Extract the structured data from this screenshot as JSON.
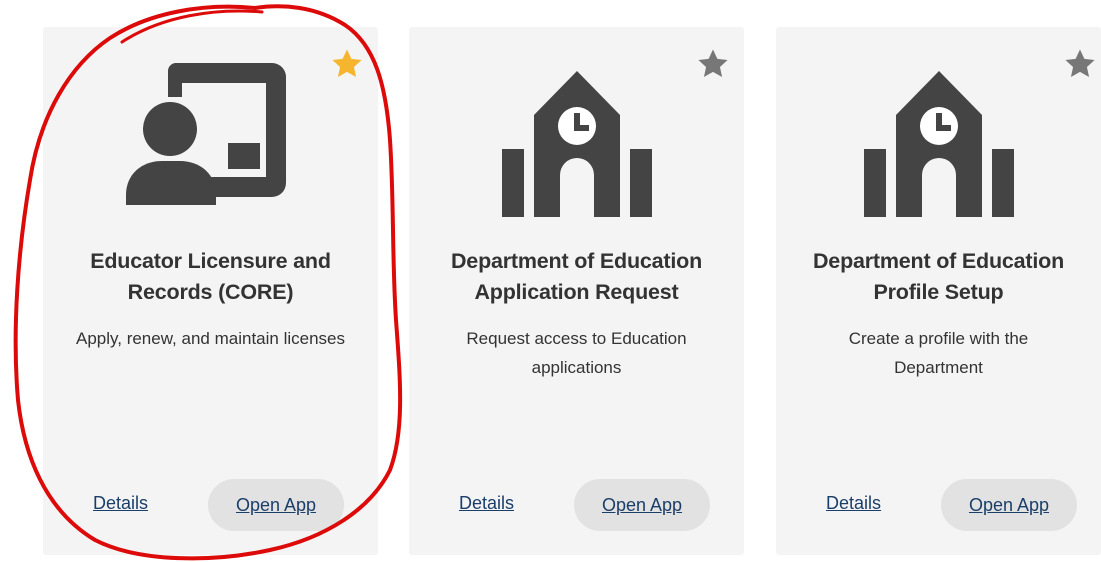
{
  "colors": {
    "card_background": "#f4f4f4",
    "text": "#333333",
    "link": "#1a3e6a",
    "icon": "#444444",
    "star_active": "#f5b52e",
    "star_inactive": "#777777",
    "button_background": "#e2e2e2",
    "annotation": "#dd0a0a"
  },
  "cards": [
    {
      "title": "Educator Licensure and Records (CORE)",
      "description": "Apply, renew, and maintain licenses",
      "details_label": "Details",
      "open_label": "Open App",
      "icon": "teacher-presentation-icon",
      "favorited": true
    },
    {
      "title": "Department of Education Application Request",
      "description": "Request access to Education applications",
      "details_label": "Details",
      "open_label": "Open App",
      "icon": "school-building-icon",
      "favorited": false
    },
    {
      "title": "Department of Education Profile Setup",
      "description": "Create a profile with the Department",
      "details_label": "Details",
      "open_label": "Open App",
      "icon": "school-building-icon",
      "favorited": false
    }
  ]
}
